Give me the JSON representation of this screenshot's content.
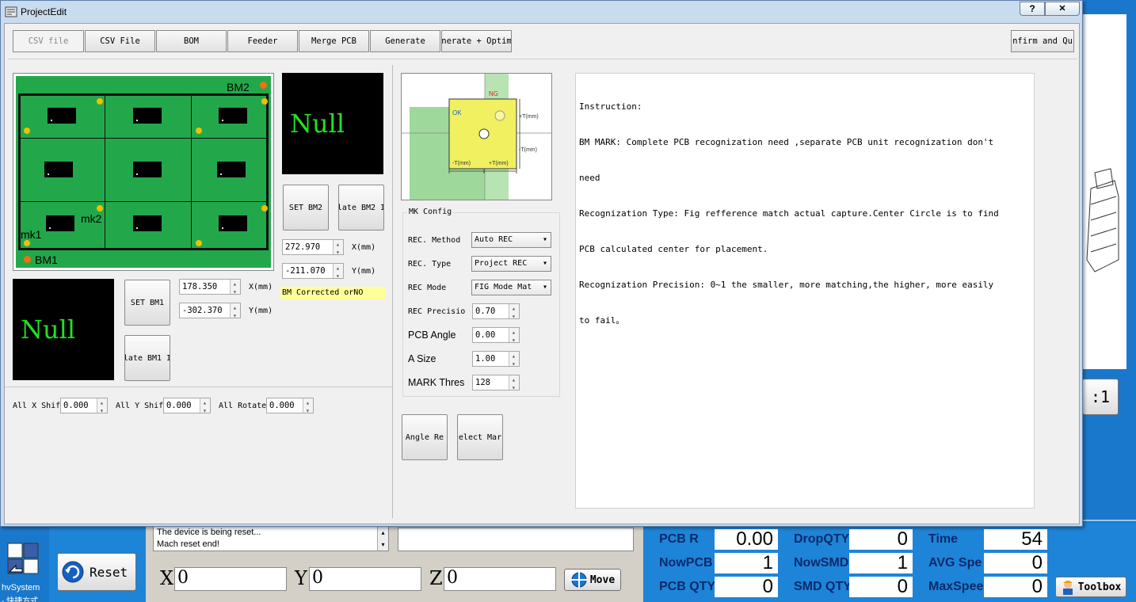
{
  "dialog": {
    "title": "ProjectEdit",
    "help_label": "?",
    "close_label": "✕"
  },
  "toolbar": {
    "buttons": [
      "CSV file",
      "CSV File",
      "BOM",
      "Feeder",
      "Merge PCB",
      "Generate",
      "enerate + Optimi"
    ],
    "confirm_label": "nfirm and Qu"
  },
  "pcb_image": {
    "labels": {
      "bm2": "BM2",
      "bm1": "BM1",
      "mk1": "mk1",
      "mk2": "mk2"
    }
  },
  "bm2": {
    "null_text": "Null",
    "set_label": "SET BM2",
    "update_label": "late BM2 I",
    "x_value": "272.970",
    "y_value": "-211.070",
    "x_unit": "X(mm)",
    "y_unit": "Y(mm)",
    "status_text": "BM Corrected orNO"
  },
  "bm1": {
    "null_text": "Null",
    "set_label": "SET BM1",
    "update_label": "late BM1 I",
    "x_value": "178.350",
    "y_value": "-302.370",
    "x_unit": "X(mm)",
    "y_unit": "Y(mm)"
  },
  "shift": {
    "x_label": "All X Shif",
    "x_value": "0.000",
    "y_label": "All Y Shif",
    "y_value": "0.000",
    "rot_label": "All Rotate",
    "rot_value": "0.000"
  },
  "diagram": {
    "ng": "NG",
    "ok": "OK",
    "t_plus_right": "+T(mm)",
    "t_minus_right": "-T(mm)",
    "t_minus_bottom": "-T(mm)",
    "t_plus_bottom": "+T(mm)"
  },
  "mk_config": {
    "title": "MK Config",
    "rec_method_label": "REC. Method",
    "rec_method_value": "Auto REC",
    "rec_type_label": "REC. Type",
    "rec_type_value": "Project REC",
    "rec_mode_label": "REC Mode",
    "rec_mode_value": "FIG  Mode Mat",
    "rec_precision_label": "REC Precisio",
    "rec_precision_value": "0.70",
    "pcb_angle_label": "PCB Angle",
    "pcb_angle_value": "0.00",
    "a_size_label": "A Size",
    "a_size_value": "1.00",
    "mark_thres_label": "MARK Thres",
    "mark_thres_value": "128"
  },
  "actions": {
    "angle_label": "Angle Re",
    "select_label": "elect Mar"
  },
  "instruction": {
    "lines": [
      "Instruction:",
      "BM MARK: Complete PCB recognization need ,separate PCB unit recognization don't",
      "need",
      "Recognization Type: Fig refference match actual capture.Center Circle is to find",
      "PCB calculated center for placement.",
      "Recognization Precision: 0~1 the smaller, more matching,the higher, more easily",
      "to fail。"
    ]
  },
  "background_app": {
    "desktop_icon_label": "hvSystem",
    "desktop_icon_sub": "- 快捷方式",
    "reset_label": "Reset",
    "log_lines": [
      "The device is being reset...",
      "Mach reset end!"
    ],
    "x_label": "X",
    "x_value": "0",
    "y_label": "Y",
    "y_value": "0",
    "z_label": "Z",
    "z_value": "0",
    "move_label": "Move",
    "side_button_label": ":1",
    "toolbox_label": "Toolbox",
    "stats": [
      {
        "label": "PCB R",
        "value": "0.00"
      },
      {
        "label": "DropQTY",
        "value": "0"
      },
      {
        "label": "Time",
        "value": "54"
      },
      {
        "label": "NowPCB",
        "value": "1"
      },
      {
        "label": "NowSMD",
        "value": "1"
      },
      {
        "label": "AVG Spe",
        "value": "0"
      },
      {
        "label": "PCB QTY",
        "value": "0"
      },
      {
        "label": "SMD QTY",
        "value": "0"
      },
      {
        "label": "MaxSpee",
        "value": "0"
      }
    ]
  },
  "colors": {
    "pcb_green": "#22a84a",
    "null_text": "#22e022",
    "status_yellow": "#ffff99",
    "app_blue": "#1a78cc"
  }
}
